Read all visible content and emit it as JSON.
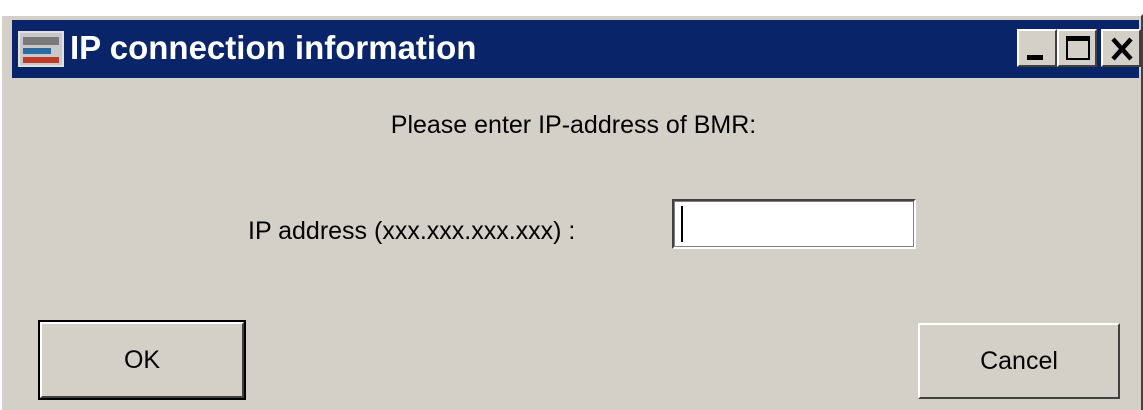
{
  "window": {
    "title": "IP connection information"
  },
  "dialog": {
    "prompt": "Please enter IP-address of BMR:",
    "ip_label": "IP address (xxx.xxx.xxx.xxx) :",
    "ip_value": "",
    "ok_label": "OK",
    "cancel_label": "Cancel"
  },
  "icons": {
    "app": "app-window-icon",
    "minimize": "minimize-icon",
    "maximize": "maximize-icon",
    "close": "close-icon"
  },
  "colors": {
    "titlebar": "#0a246a",
    "face": "#d4d0c8",
    "title_text": "#ffffff"
  }
}
